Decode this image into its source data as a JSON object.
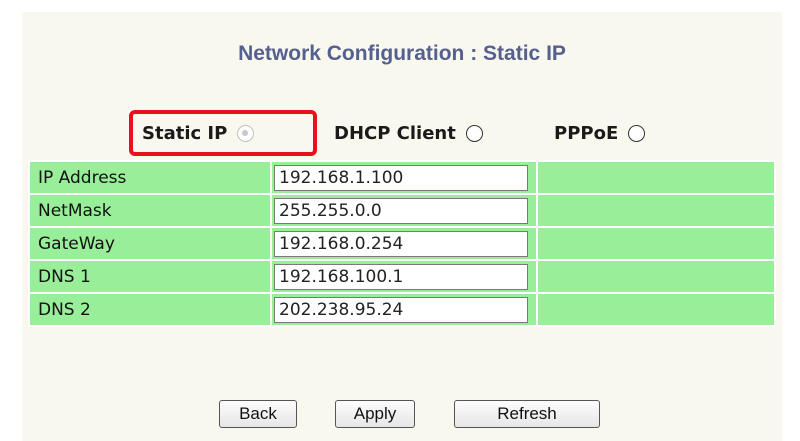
{
  "page": {
    "title": "Network Configuration : Static IP"
  },
  "modes": [
    {
      "label": "Static IP",
      "selected": true,
      "disabled": true
    },
    {
      "label": "DHCP Client",
      "selected": false,
      "disabled": false
    },
    {
      "label": "PPPoE",
      "selected": false,
      "disabled": false
    }
  ],
  "fields": [
    {
      "label": "IP Address",
      "value": "192.168.1.100"
    },
    {
      "label": "NetMask",
      "value": "255.255.0.0"
    },
    {
      "label": "GateWay",
      "value": "192.168.0.254"
    },
    {
      "label": "DNS 1",
      "value": "192.168.100.1"
    },
    {
      "label": "DNS 2",
      "value": "202.238.95.24"
    }
  ],
  "buttons": {
    "back": "Back",
    "apply": "Apply",
    "refresh": "Refresh"
  },
  "colors": {
    "row_bg": "#99ee99",
    "title": "#55608f",
    "highlight": "#e8101c",
    "panel_bg": "#f8f8ee"
  }
}
